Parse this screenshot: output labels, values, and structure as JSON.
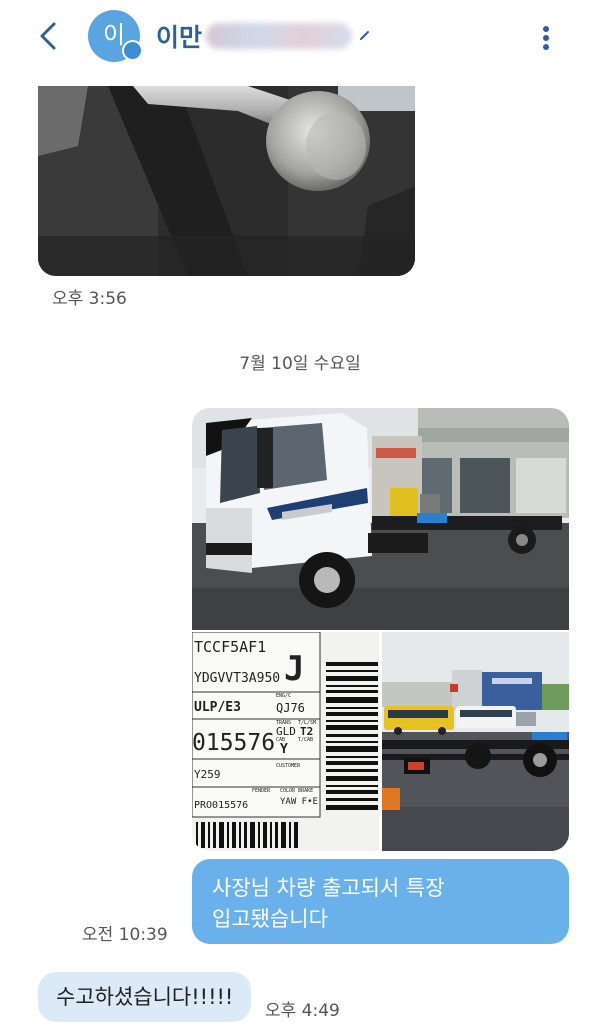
{
  "header": {
    "avatar_initial": "이",
    "contact_name": "이만",
    "icons": {
      "back": "chevron-left-icon",
      "more": "more-vertical-icon",
      "name_expand": "chevron-icon"
    },
    "colors": {
      "avatar": "#5aa5e0",
      "name": "#2f5f98"
    }
  },
  "messages": {
    "first_image_time": "오후 3:56",
    "date_divider": "7월 10일 수요일",
    "photo_label": {
      "line1": "TCCF5AF1",
      "line2": "YDGVVT3A950",
      "letter": "J",
      "line3": "ULP/E3",
      "eng_code": "QJ76",
      "trans": "GLD",
      "axle": "T2",
      "serial": "015576",
      "cab": "Y",
      "code": "Y259",
      "customer": "CUSTOMER",
      "fender": "FENDER",
      "color_brake": "COLOR BRAKE",
      "color_values": "YAW F•E",
      "pro": "PRO015576",
      "small_eng": "ENG/C",
      "small_trans": "TRANS",
      "small_tlsm": "T/L/SM",
      "small_cab": "CAB",
      "small_tcab": "T/CAB"
    },
    "outgoing_text_line1": "사장님 차량 출고되서 특장",
    "outgoing_text_line2": "입고됐습니다",
    "outgoing_time": "오전 10:39",
    "incoming_text": "수고하셨습니다!!!!!",
    "incoming_time": "오후 4:49",
    "colors": {
      "outgoing_bubble": "#6ab1ec",
      "incoming_bubble": "#dceaf8"
    }
  }
}
